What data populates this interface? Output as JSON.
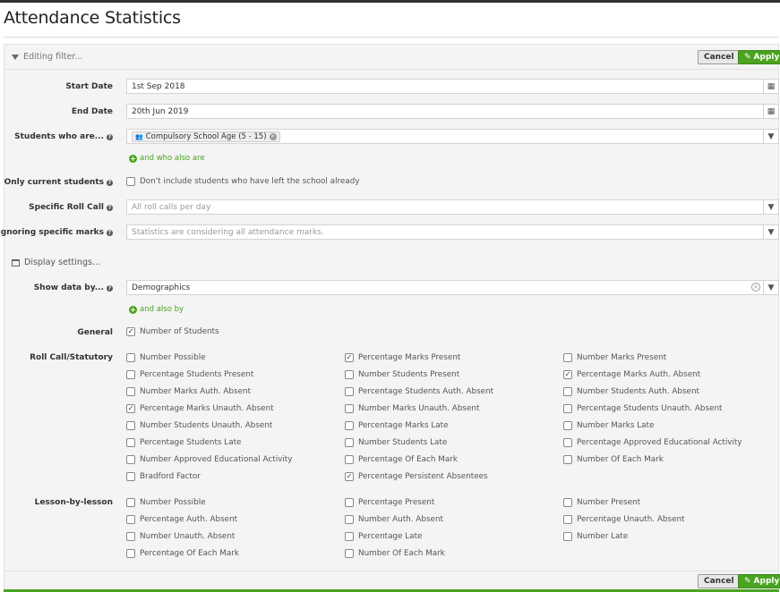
{
  "page": {
    "title": "Attendance Statistics"
  },
  "filter": {
    "editing_label": "Editing filter...",
    "cancel_label": "Cancel",
    "apply_label": "Apply",
    "start_date": {
      "label": "Start Date",
      "value": "1st Sep 2018"
    },
    "end_date": {
      "label": "End Date",
      "value": "20th Jun 2019"
    },
    "students": {
      "label": "Students who are...",
      "tag": "Compulsory School Age (5 - 15)",
      "add_link": "and who also are"
    },
    "only_current": {
      "label": "Only current students",
      "checkbox_label": "Don't include students who have left the school already",
      "checked": false
    },
    "roll_call": {
      "label": "Specific Roll Call",
      "placeholder": "All roll calls per day"
    },
    "ignoring": {
      "label": "Ignoring specific marks",
      "placeholder": "Statistics are considering all attendance marks."
    }
  },
  "display": {
    "label": "Display settings...",
    "show_by": {
      "label": "Show data by...",
      "value": "Demographics",
      "add_link": "and also by"
    },
    "general": {
      "label": "General",
      "items": [
        {
          "label": "Number of Students",
          "checked": true
        }
      ]
    },
    "roll_call": {
      "label": "Roll Call/Statutory",
      "columns": [
        [
          {
            "label": "Number Possible",
            "checked": false
          },
          {
            "label": "Percentage Students Present",
            "checked": false
          },
          {
            "label": "Number Marks Auth. Absent",
            "checked": false
          },
          {
            "label": "Percentage Marks Unauth. Absent",
            "checked": true
          },
          {
            "label": "Number Students Unauth. Absent",
            "checked": false
          },
          {
            "label": "Percentage Students Late",
            "checked": false
          },
          {
            "label": "Number Approved Educational Activity",
            "checked": false
          },
          {
            "label": "Bradford Factor",
            "checked": false
          }
        ],
        [
          {
            "label": "Percentage Marks Present",
            "checked": true
          },
          {
            "label": "Number Students Present",
            "checked": false
          },
          {
            "label": "Percentage Students Auth. Absent",
            "checked": false
          },
          {
            "label": "Number Marks Unauth. Absent",
            "checked": false
          },
          {
            "label": "Percentage Marks Late",
            "checked": false
          },
          {
            "label": "Number Students Late",
            "checked": false
          },
          {
            "label": "Percentage Of Each Mark",
            "checked": false
          },
          {
            "label": "Percentage Persistent Absentees",
            "checked": true
          }
        ],
        [
          {
            "label": "Number Marks Present",
            "checked": false
          },
          {
            "label": "Percentage Marks Auth. Absent",
            "checked": true
          },
          {
            "label": "Number Students Auth. Absent",
            "checked": false
          },
          {
            "label": "Percentage Students Unauth. Absent",
            "checked": false
          },
          {
            "label": "Number Marks Late",
            "checked": false
          },
          {
            "label": "Percentage Approved Educational Activity",
            "checked": false
          },
          {
            "label": "Number Of Each Mark",
            "checked": false
          }
        ]
      ]
    },
    "lesson": {
      "label": "Lesson-by-lesson",
      "columns": [
        [
          {
            "label": "Number Possible",
            "checked": false
          },
          {
            "label": "Percentage Auth. Absent",
            "checked": false
          },
          {
            "label": "Number Unauth. Absent",
            "checked": false
          },
          {
            "label": "Percentage Of Each Mark",
            "checked": false
          }
        ],
        [
          {
            "label": "Percentage Present",
            "checked": false
          },
          {
            "label": "Number Auth. Absent",
            "checked": false
          },
          {
            "label": "Percentage Late",
            "checked": false
          },
          {
            "label": "Number Of Each Mark",
            "checked": false
          }
        ],
        [
          {
            "label": "Number Present",
            "checked": false
          },
          {
            "label": "Percentage Unauth. Absent",
            "checked": false
          },
          {
            "label": "Number Late",
            "checked": false
          }
        ]
      ]
    }
  },
  "colors": {
    "accent": "#4aa321",
    "panel_bg": "#f4f4f4"
  }
}
